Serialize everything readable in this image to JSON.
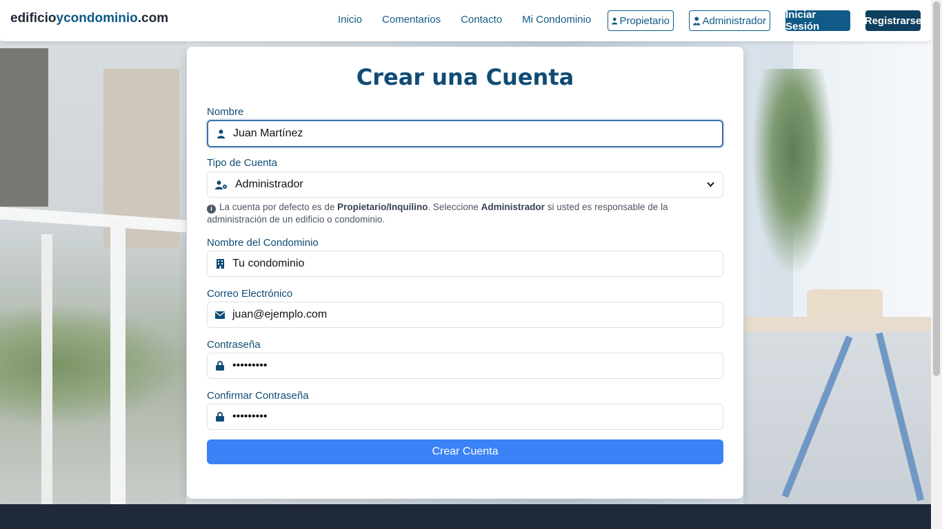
{
  "header": {
    "logo_part1": "edificio",
    "logo_part2": "ycondominio",
    "logo_part3": ".com",
    "nav": [
      {
        "label": "Inicio"
      },
      {
        "label": "Comentarios"
      },
      {
        "label": "Contacto"
      },
      {
        "label": "Mi Condominio"
      }
    ],
    "propietario_label": "Propietario",
    "administrador_label": "Administrador",
    "login_label": "Iniciar Sesión",
    "register_label": "Registrarse"
  },
  "form": {
    "title": "Crear una Cuenta",
    "name_label": "Nombre",
    "name_value": "Juan Martínez",
    "type_label": "Tipo de Cuenta",
    "type_value": "Administrador",
    "help_prefix": "La cuenta por defecto es de ",
    "help_bold1": "Propietario/Inquilino",
    "help_mid": ". Seleccione ",
    "help_bold2": "Administrador",
    "help_suffix": " si usted es responsable de la administración de un edificio o condominio.",
    "condo_label": "Nombre del Condominio",
    "condo_value": "Tu condominio",
    "email_label": "Correo Electrónico",
    "email_value": "juan@ejemplo.com",
    "password_label": "Contraseña",
    "password_value": "•••••••••",
    "confirm_label": "Confirmar Contraseña",
    "confirm_value": "•••••••••",
    "submit_label": "Crear Cuenta"
  },
  "colors": {
    "primary": "#0f5a86",
    "title": "#0f4c75",
    "login_bg": "#0f5a86",
    "register_bg": "#0d3f5f",
    "submit_bg": "#3b82f6",
    "footer_bg": "#1f2937"
  },
  "icons": {
    "name": "user-icon",
    "type": "user-gear-icon",
    "condo": "building-icon",
    "email": "envelope-icon",
    "password": "lock-icon",
    "info": "info-circle-icon"
  }
}
